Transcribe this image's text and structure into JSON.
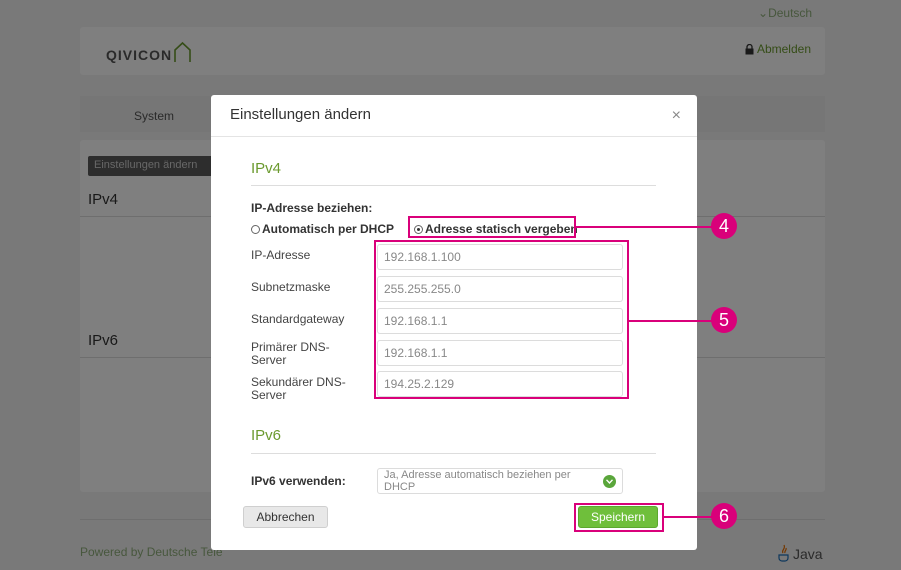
{
  "background": {
    "language": "Deutsch",
    "logo_text": "QIVICON",
    "logout_label": "Abmelden",
    "tab_system": "System",
    "button_label": "Einstellungen ändern",
    "section_ipv4": "IPv4",
    "section_ipv6": "IPv6",
    "footer_text": "Powered by Deutsche Tele",
    "java_label": "Java"
  },
  "dialog": {
    "title": "Einstellungen ändern",
    "close_label": "×",
    "ipv4": {
      "section_title": "IPv4",
      "obtain_label": "IP-Adresse beziehen:",
      "radio_dhcp": "Automatisch per DHCP",
      "radio_static": "Adresse statisch vergeben",
      "selected": "static",
      "fields": [
        {
          "label": "IP-Adresse",
          "value": "192.168.1.100"
        },
        {
          "label": "Subnetzmaske",
          "value": "255.255.255.0"
        },
        {
          "label": "Standardgateway",
          "value": "192.168.1.1"
        },
        {
          "label": "Primärer DNS-Server",
          "value": "192.168.1.1"
        },
        {
          "label": "Sekundärer DNS-Server",
          "value": "194.25.2.129"
        }
      ]
    },
    "ipv6": {
      "section_title": "IPv6",
      "use_label": "IPv6 verwenden:",
      "select_value": "Ja, Adresse automatisch beziehen per DHCP"
    },
    "cancel_label": "Abbrechen",
    "save_label": "Speichern"
  },
  "callouts": [
    "4",
    "5",
    "6"
  ],
  "colors": {
    "accent_green": "#6b9a2e",
    "save_green": "#6fbf3b",
    "highlight_magenta": "#d9007a"
  }
}
